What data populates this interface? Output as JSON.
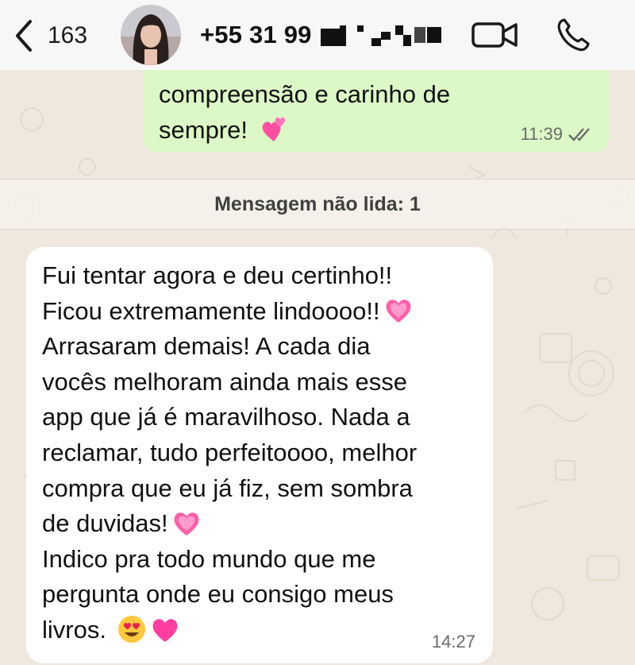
{
  "header": {
    "back_count": "163",
    "contact_phone": "+55 31 99",
    "icons": {
      "back": "chevron-left-icon",
      "video": "video-call-icon",
      "call": "phone-call-icon"
    }
  },
  "messages": {
    "outgoing": {
      "lines": [
        "compreensão e carinho de",
        "sempre!"
      ],
      "emoji": "💕",
      "time": "11:39",
      "status": "read-double-check"
    },
    "unread_banner": "Mensagem não lida: 1",
    "incoming": {
      "lines": [
        "Fui tentar agora e deu certinho!!",
        "Ficou extremamente lindoooo!!",
        "Arrasaram demais! A cada dia",
        "vocês melhoram ainda mais esse",
        "app que já é maravilhoso. Nada a",
        "reclamar, tudo perfeitoooo, melhor",
        "compra que eu já fiz, sem sombra",
        "de duvidas!",
        "Indico pra todo mundo que me",
        "pergunta onde eu consigo meus",
        "livros."
      ],
      "emojis": [
        "💗",
        "💗",
        "😍",
        "🩷"
      ],
      "time": "14:27"
    }
  },
  "colors": {
    "chat_background": "#efe8df",
    "outgoing_bubble": "#dcf8c6",
    "incoming_bubble": "#ffffff",
    "header_background": "#f7f7f7"
  }
}
